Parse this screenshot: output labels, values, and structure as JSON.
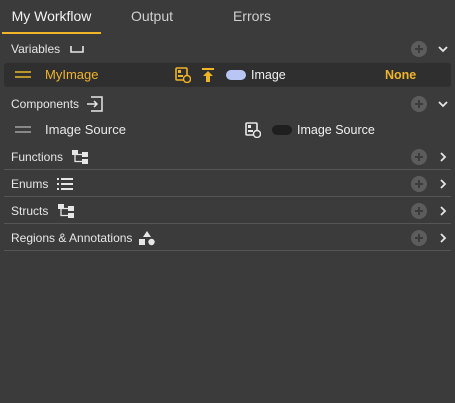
{
  "tabs": [
    {
      "label": "My Workflow",
      "active": true
    },
    {
      "label": "Output",
      "active": false
    },
    {
      "label": "Errors",
      "active": false
    }
  ],
  "colors": {
    "accent": "#f0b429",
    "background": "#3b3b3b",
    "image_pill": "#b9c6f5",
    "image_source_pill": "#1f1f1f"
  },
  "sections": {
    "variables": {
      "label": "Variables",
      "icon": "variable-bracket-icon",
      "expanded": true
    },
    "components": {
      "label": "Components",
      "icon": "input-arrow-icon",
      "expanded": true
    },
    "functions": {
      "label": "Functions",
      "icon": "hierarchy-icon",
      "expanded": false
    },
    "enums": {
      "label": "Enums",
      "icon": "list-icon",
      "expanded": false
    },
    "structs": {
      "label": "Structs",
      "icon": "hierarchy-icon",
      "expanded": false
    },
    "regions": {
      "label": "Regions & Annotations",
      "icon": "shapes-icon",
      "expanded": false
    }
  },
  "variables": [
    {
      "name": "MyImage",
      "type": "Image",
      "value": "None",
      "icons": [
        "image-link-icon",
        "expose-upload-icon"
      ],
      "selected": true
    }
  ],
  "components": [
    {
      "name": "Image Source",
      "type": "Image Source",
      "icons": [
        "image-link-icon"
      ]
    }
  ]
}
